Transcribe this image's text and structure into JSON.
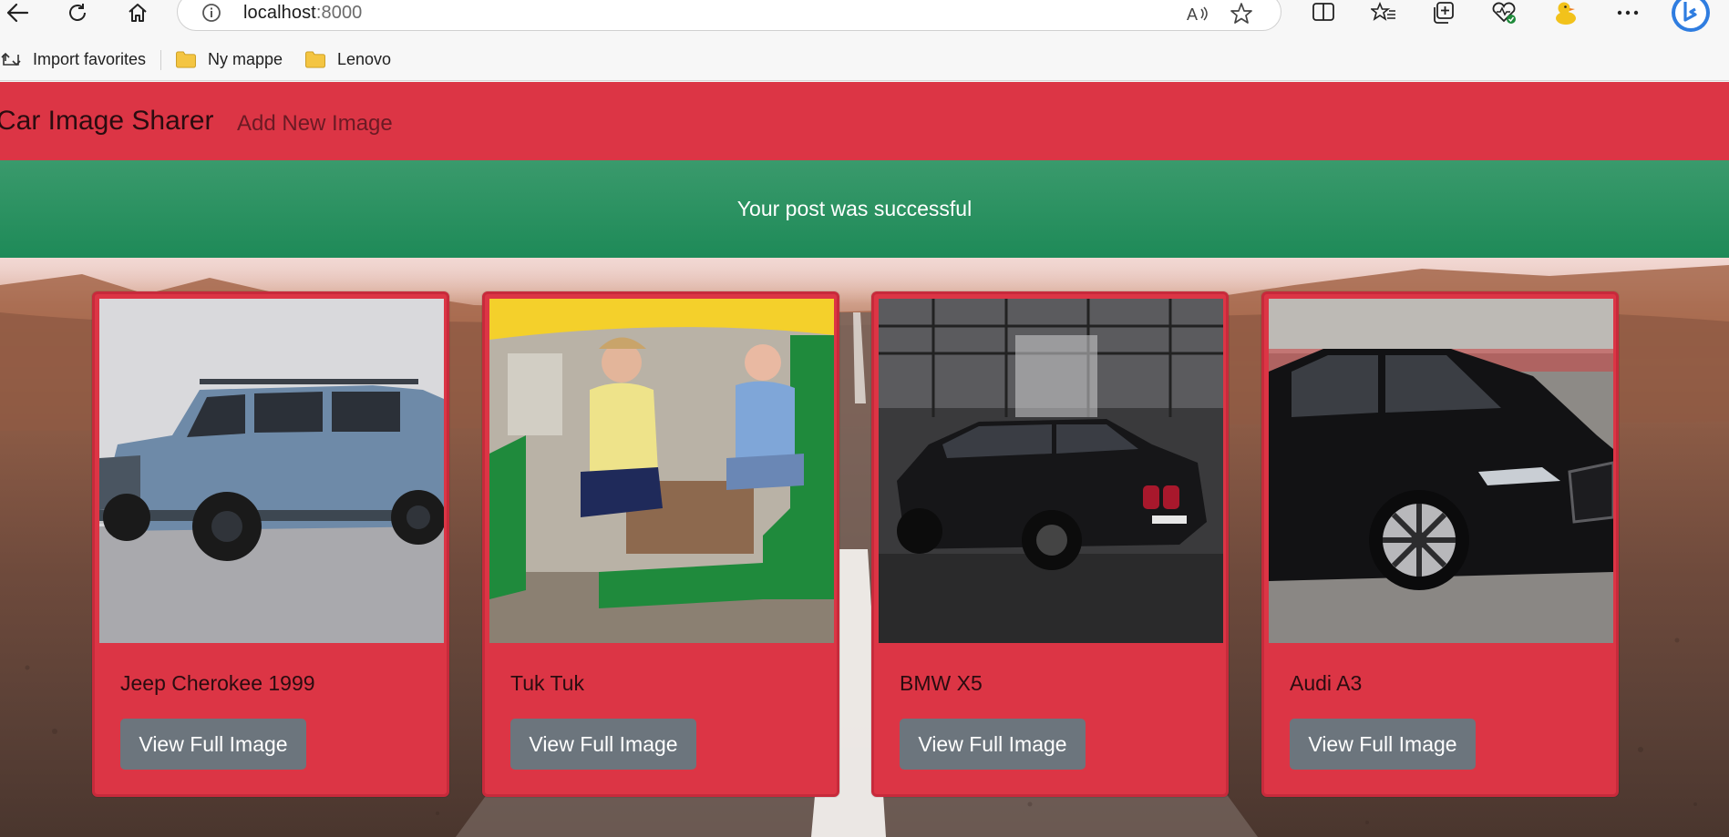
{
  "browser": {
    "url_host": "localhost",
    "url_port": ":8000",
    "favorites": [
      {
        "label": "Import favorites",
        "icon": "import-icon"
      },
      {
        "label": "Ny mappe",
        "icon": "folder-icon"
      },
      {
        "label": "Lenovo",
        "icon": "folder-icon"
      }
    ]
  },
  "app": {
    "brand": "Car Image Sharer",
    "nav_link": "Add New Image",
    "accent_color": "#dc3545",
    "alert_color": "#28a05f"
  },
  "alert": {
    "message": "Your post was successful"
  },
  "cards": [
    {
      "title": "Jeep Cherokee 1999",
      "button": "View Full Image"
    },
    {
      "title": "Tuk Tuk",
      "button": "View Full Image"
    },
    {
      "title": "BMW X5",
      "button": "View Full Image"
    },
    {
      "title": "Audi A3",
      "button": "View Full Image"
    }
  ]
}
